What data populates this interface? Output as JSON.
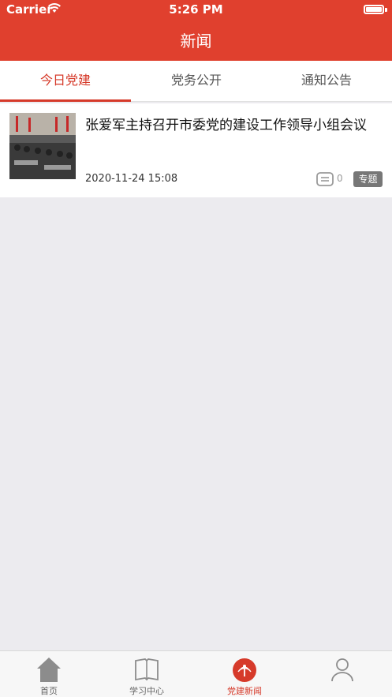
{
  "status_bar": {
    "carrier": "Carrier",
    "time": "5:26 PM"
  },
  "nav": {
    "title": "新闻"
  },
  "tabs": [
    {
      "label": "今日党建",
      "active": true
    },
    {
      "label": "党务公开",
      "active": false
    },
    {
      "label": "通知公告",
      "active": false
    }
  ],
  "news": [
    {
      "title": "张爱军主持召开市委党的建设工作领导小组会议",
      "date": "2020-11-24 15:08",
      "comments": "0",
      "tag": "专题"
    }
  ],
  "tabbar": [
    {
      "label": "首页",
      "icon": "home-icon"
    },
    {
      "label": "学习中心",
      "icon": "book-icon"
    },
    {
      "label": "党建新闻",
      "icon": "party-news-icon",
      "active": true
    },
    {
      "label": "",
      "icon": "profile-icon"
    }
  ],
  "colors": {
    "brand_red": "#e0402e",
    "active_red": "#d63a2a",
    "tag_gray": "#777777"
  }
}
